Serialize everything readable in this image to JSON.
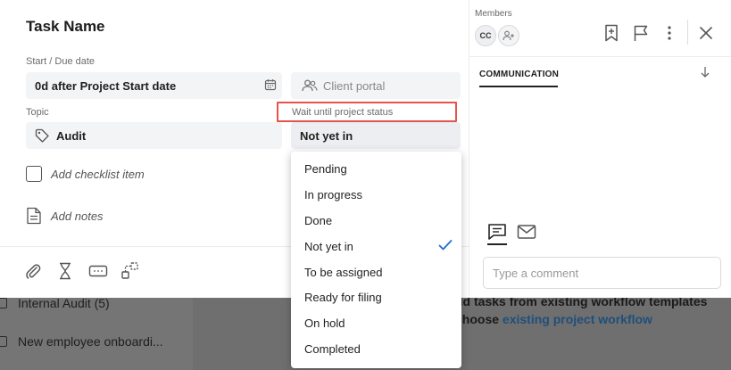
{
  "background": {
    "list_items": [
      "Internal Audit (5)",
      "New employee onboardi..."
    ],
    "cta_line1": "dd tasks from existing workflow templates",
    "cta_line2_prefix": "choose ",
    "cta_link": "existing project workflow"
  },
  "task": {
    "title": "Task Name",
    "date_label": "Start / Due date",
    "date_value": "0d after Project Start date",
    "portal_placeholder": "Client portal",
    "topic_label": "Topic",
    "topic_value": "Audit",
    "status_label": "Wait until project status",
    "status_value": "Not yet in",
    "checklist_placeholder": "Add checklist item",
    "notes_placeholder": "Add notes"
  },
  "status_dropdown": {
    "options": [
      "Pending",
      "In progress",
      "Done",
      "Not yet in",
      "To be assigned",
      "Ready for filing",
      "On hold",
      "Completed"
    ],
    "selected": "Not yet in"
  },
  "sidebar": {
    "members_label": "Members",
    "member_initials": "CC",
    "tab_label": "COMMUNICATION",
    "comment_placeholder": "Type a comment"
  },
  "colors": {
    "accent_blue": "#1f6fd0",
    "highlight_red": "#e5534b"
  },
  "icons": {
    "calendar": "calendar-icon",
    "portal": "users-icon",
    "topic": "tag-icon",
    "notes": "document-icon",
    "attachment": "paperclip-icon",
    "timer": "hourglass-icon",
    "field": "input-field-icon",
    "dependency": "dependency-icon",
    "bookmark": "bookmark-add-icon",
    "flag": "flag-icon",
    "more": "more-vertical-icon",
    "close": "close-icon",
    "sort": "arrow-down-icon",
    "chat": "chat-icon",
    "mail": "mail-icon",
    "add_member": "add-member-icon",
    "check": "check-icon"
  }
}
